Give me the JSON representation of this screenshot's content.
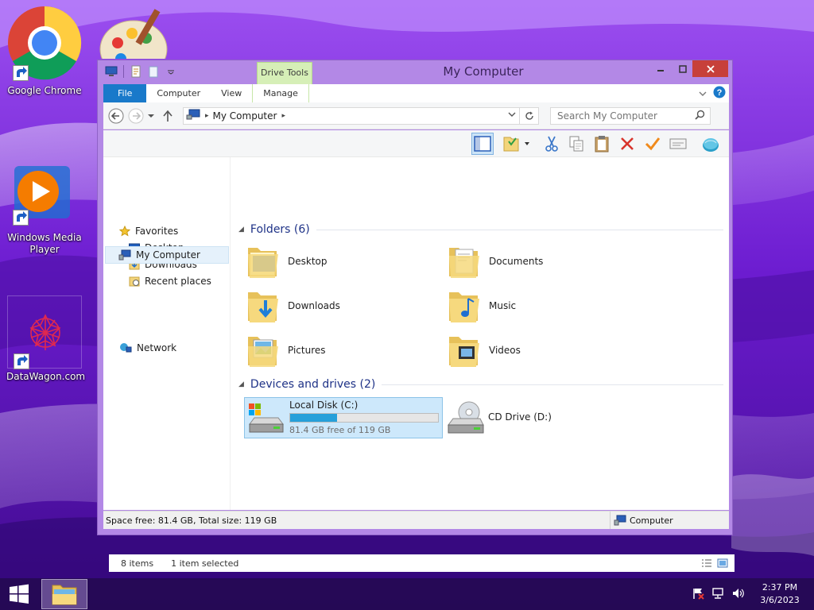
{
  "desktop": {
    "icons": [
      {
        "label": "Google Chrome",
        "icon": "chrome-icon"
      },
      {
        "label": "",
        "icon": "paint-icon"
      },
      {
        "label": "Windows Media Player",
        "icon": "media-player-icon"
      },
      {
        "label": "DataWagon.com",
        "icon": "datawagon-icon"
      }
    ]
  },
  "window": {
    "title": "My Computer",
    "context_tab_group": "Drive Tools",
    "ribbon_tabs": [
      "File",
      "Computer",
      "View",
      "Manage"
    ],
    "address": {
      "crumb": "My Computer"
    },
    "search": {
      "placeholder": "Search My Computer"
    },
    "navpane": {
      "favorites": "Favorites",
      "items": [
        "Desktop",
        "Downloads",
        "Recent places"
      ],
      "my_computer": "My Computer",
      "network": "Network"
    },
    "folders": {
      "header": "Folders (6)",
      "items": [
        "Desktop",
        "Documents",
        "Downloads",
        "Music",
        "Pictures",
        "Videos"
      ]
    },
    "devices": {
      "header": "Devices and drives (2)",
      "drive_c": {
        "name": "Local Disk (C:)",
        "free_text": "81.4 GB free of 119 GB",
        "used_fraction": 0.316
      },
      "drive_d": {
        "name": "CD Drive (D:)"
      }
    },
    "status": {
      "items": "8 items",
      "selected": "1 item selected",
      "space": "Space free: 81.4 GB, Total size: 119 GB",
      "location": "Computer"
    }
  },
  "taskbar": {
    "time": "2:37 PM",
    "date": "3/6/2023"
  },
  "colors": {
    "accent": "#1979ca",
    "progress": "#26a0da",
    "selection": "#cde8fb",
    "window_frame": "#b388e6",
    "close_button": "#c7403a",
    "wallpaper": "#6a1fb8"
  }
}
